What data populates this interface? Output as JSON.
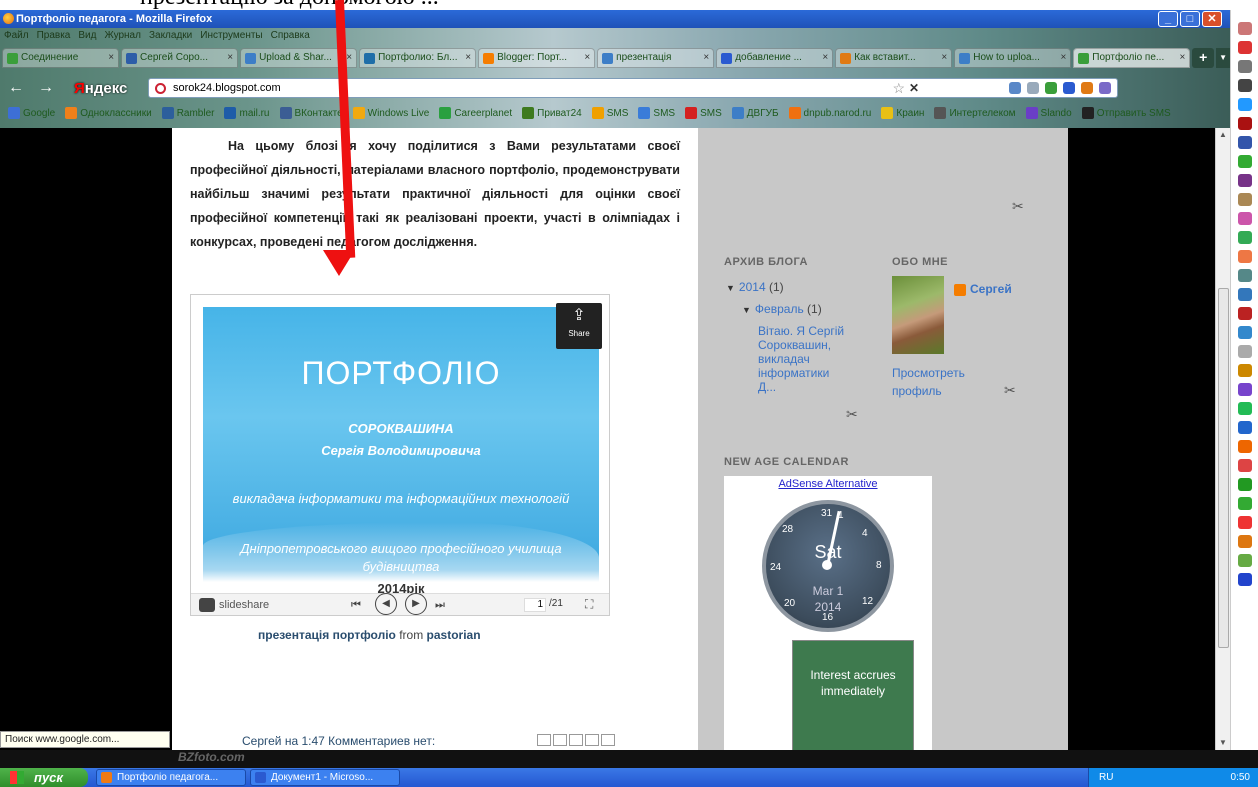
{
  "caption_top": "презентацію за допомогою ...",
  "window": {
    "title": "Портфоліо педагога - Mozilla Firefox",
    "controls": [
      "_",
      "□",
      "✕"
    ]
  },
  "menu": [
    "Файл",
    "Правка",
    "Вид",
    "Журнал",
    "Закладки",
    "Инструменты",
    "Справка"
  ],
  "tabs": [
    {
      "label": "Соединение",
      "color": "#3a9e3a"
    },
    {
      "label": "Сергей Соро...",
      "color": "#2d5da8"
    },
    {
      "label": "Upload & Shar...",
      "color": "#3d7ec7"
    },
    {
      "label": "Портфолио: Бл...",
      "color": "#1f6ea8"
    },
    {
      "label": "Blogger: Порт...",
      "color": "#f57d00"
    },
    {
      "label": "презентація",
      "color": "#3d7ec7"
    },
    {
      "label": "добавление ...",
      "color": "#2a5ad0"
    },
    {
      "label": "Как вставит...",
      "color": "#e07a14"
    },
    {
      "label": "How to uploa...",
      "color": "#3d7ec7"
    },
    {
      "label": "Портфоліо пе...",
      "color": "#3a9e3a"
    }
  ],
  "nav": {
    "back": "←",
    "forward": "→",
    "yandex_first": "Я",
    "yandex_rest": "ндекс",
    "url": "sorok24.blogspot.com",
    "star": "☆",
    "stop": "✕"
  },
  "bookmarks": [
    {
      "label": "Google",
      "color": "#3d6fd6"
    },
    {
      "label": "Одноклассники",
      "color": "#f0801a"
    },
    {
      "label": "Rambler",
      "color": "#2c5f9c"
    },
    {
      "label": "mail.ru",
      "color": "#1e5ca8"
    },
    {
      "label": "ВКонтакте",
      "color": "#3b5d94"
    },
    {
      "label": "Windows Live",
      "color": "#f2a90f"
    },
    {
      "label": "Сareerplanet",
      "color": "#2aa040"
    },
    {
      "label": "Приват24",
      "color": "#3e7a1e"
    },
    {
      "label": "SMS",
      "color": "#f0a000"
    },
    {
      "label": "SMS",
      "color": "#3a7cd9"
    },
    {
      "label": "SMS",
      "color": "#d42020"
    },
    {
      "label": "ДВГУБ",
      "color": "#3d7ec7"
    },
    {
      "label": "dnpub.narod.ru",
      "color": "#f07010"
    },
    {
      "label": "Краин",
      "color": "#e8c014"
    },
    {
      "label": "Интертелеком",
      "color": "#555555"
    },
    {
      "label": "Slando",
      "color": "#6a3ec7"
    },
    {
      "label": "Отправить SMS",
      "color": "#222222"
    }
  ],
  "post": {
    "intro": "На цьому блозі я хочу поділитися з Вами результатами своєї професійної діяльності, матеріалами власного портфоліо, продемонструвати найбільш значимі результати практичної діяльності для оцінки своєї професійної компетенції, такі як реалізовані проекти, участі в олімпіадах і конкурсах, проведені педагогом дослідження.",
    "slide": {
      "title": "ПОРТФОЛІО",
      "surname": "СОРОКВАШИНА",
      "name": "Сергія Володимировича",
      "position": "викладача інформатики та інформаційних технологій",
      "institution": "Дніпропетровського вищого професійного училища будівництва",
      "year": "2014рік"
    },
    "share_label": "Share",
    "player": {
      "brand": "slideshare",
      "first": "⏮",
      "prev": "◀",
      "next": "▶",
      "last": "⏭",
      "current_page": "1",
      "total": "/21",
      "fullscreen": "⛶"
    },
    "caption_link": "презентація портфоліо",
    "caption_from": " from ",
    "caption_author": "pastorian",
    "footer": "Сергей на 1:47    Комментариев нет:"
  },
  "sidebar": {
    "archive_heading": "АРХИВ БЛОГА",
    "about_heading": "ОБО МНЕ",
    "year": "2014",
    "year_count": "(1)",
    "month": "Февраль",
    "month_count": "(1)",
    "post_title": "Вітаю. Я Сергій Сорокваш­ин, викладач інформатики Д...",
    "profile_name": "Сергей",
    "profile_link": "Просмотреть профиль",
    "calendar_heading": "NEW AGE CALENDAR",
    "ad_link": "AdSense Alternative",
    "clock_day": "Sat",
    "clock_date": "Mar 1",
    "clock_year": "2014",
    "clock_nums": {
      "n31": "31",
      "n1": "1",
      "n4": "4",
      "n8": "8",
      "n12": "12",
      "n16": "16",
      "n20": "20",
      "n24": "24",
      "n28": "28"
    },
    "ad_text": "Interest accrues immediately"
  },
  "status_tip": "Поиск www.google.com...",
  "watermark": "BZfoto.com",
  "taskbar": {
    "start": "пуск",
    "tasks": [
      {
        "label": "Портфоліо педагога...",
        "color": "#f07a14"
      },
      {
        "label": "Документ1 - Microso...",
        "color": "#2a5ad0"
      }
    ],
    "lang": "RU",
    "time": "0:50"
  }
}
